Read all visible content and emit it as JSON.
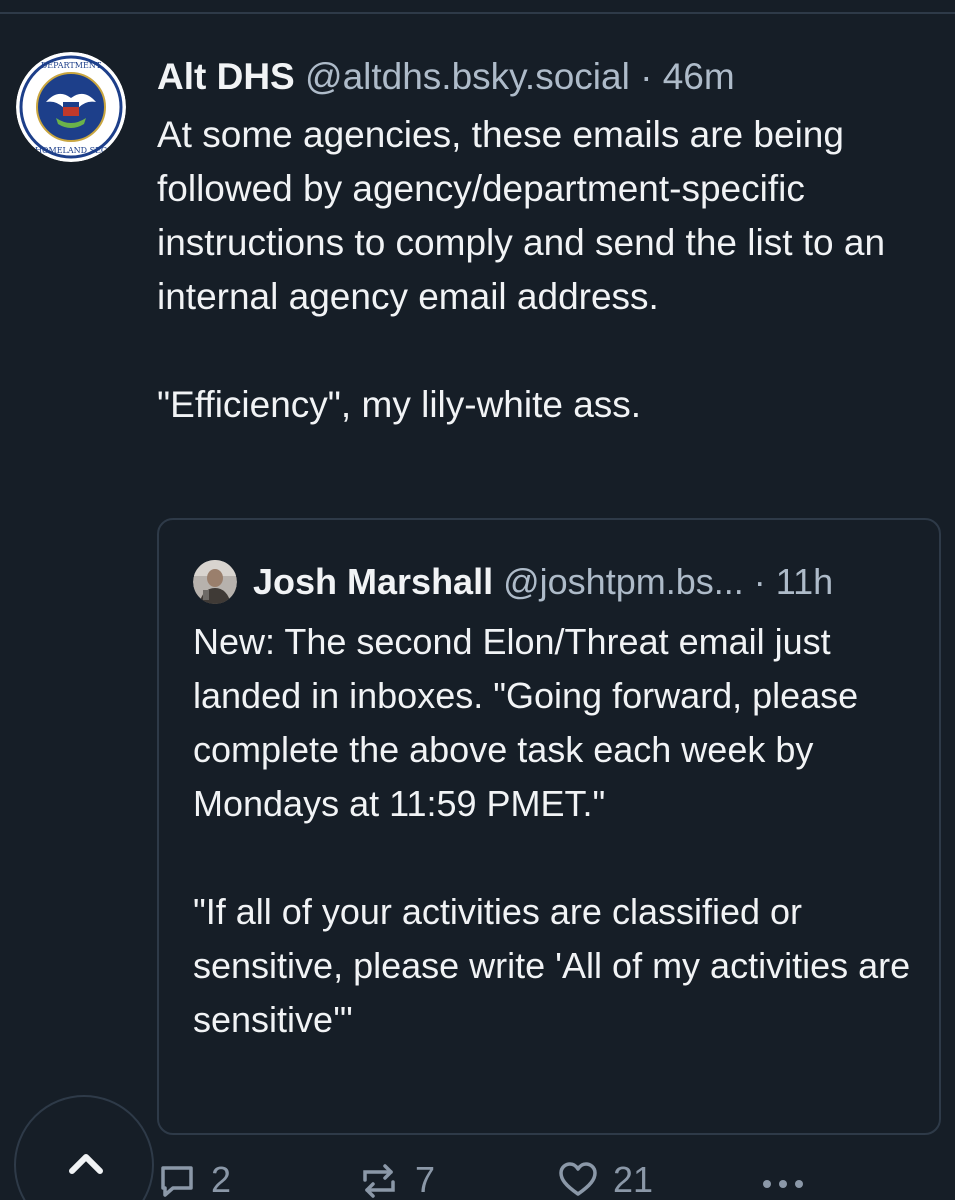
{
  "post": {
    "author": {
      "display_name": "Alt DHS",
      "handle": "@altdhs.bsky.social",
      "separator": "·",
      "time": "46m"
    },
    "paragraphs": [
      "At some agencies, these emails are being followed by agency/department-specific instructions to comply and send the list to an internal agency email address.",
      "\"Efficiency\", my lily-white ass."
    ]
  },
  "quote": {
    "author": {
      "display_name": "Josh Marshall",
      "handle": "@joshtpm.bs...",
      "separator": "·",
      "time": "11h"
    },
    "paragraphs": [
      "New: The second Elon/Threat email just landed in inboxes. \"Going forward, please complete the above task each week by Mondays at 11:59 PMET.\"",
      "\"If all of your activities are classified or sensitive, please write 'All of my activities are sensitive'\""
    ]
  },
  "actions": {
    "replies": "2",
    "reposts": "7",
    "likes": "21"
  },
  "icons": {
    "avatar": "dhs-seal-icon",
    "quote_avatar": "user-photo-icon",
    "reply": "speech-bubble-icon",
    "repost": "repost-arrows-icon",
    "like": "heart-icon",
    "more": "ellipsis-icon",
    "scroll_top": "chevron-up-icon"
  },
  "colors": {
    "background": "#161e27",
    "text_primary": "#f1f3f5",
    "text_secondary": "#aebbc9",
    "border": "#2e3a48",
    "icon": "#8b98a8"
  }
}
